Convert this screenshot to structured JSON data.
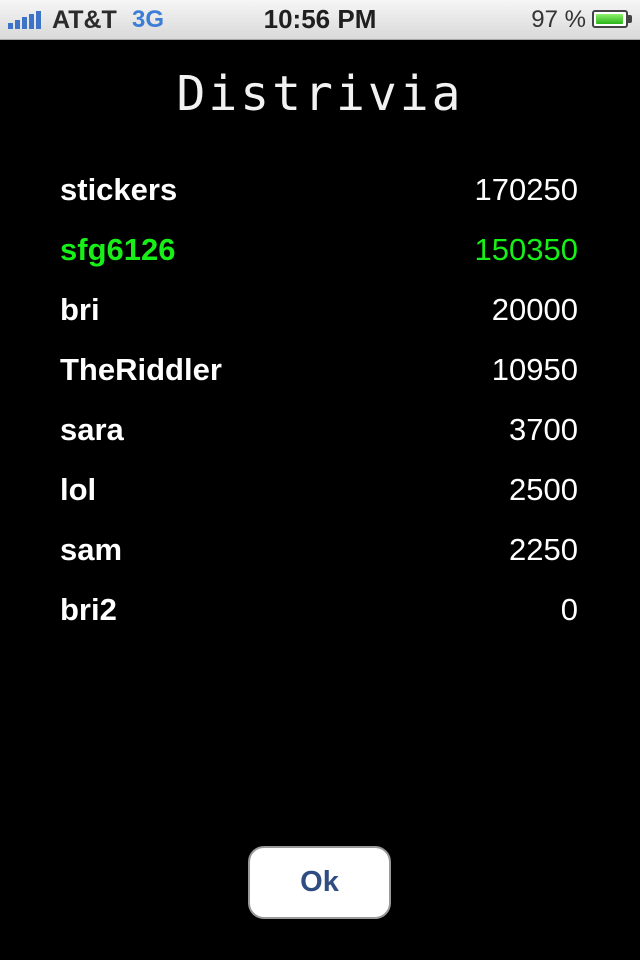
{
  "status_bar": {
    "carrier": "AT&T",
    "network": "3G",
    "time": "10:56 PM",
    "battery_percent": "97 %",
    "battery_level": 0.97
  },
  "title": "Distrivia",
  "scores": [
    {
      "name": "stickers",
      "score": "170250"
    },
    {
      "name": "sfg6126",
      "score": "150350",
      "highlight": true
    },
    {
      "name": "bri",
      "score": "20000"
    },
    {
      "name": "TheRiddler",
      "score": "10950"
    },
    {
      "name": "sara",
      "score": "3700"
    },
    {
      "name": "lol",
      "score": "2500"
    },
    {
      "name": "sam",
      "score": "2250"
    },
    {
      "name": "bri2",
      "score": "0"
    }
  ],
  "ok_button": {
    "label": "Ok"
  },
  "colors": {
    "background": "#000000",
    "text": "#ffffff",
    "highlight": "#18ee18",
    "button_text": "#2f4d80",
    "signal": "#3e74c8",
    "network": "#3c7dd6"
  }
}
